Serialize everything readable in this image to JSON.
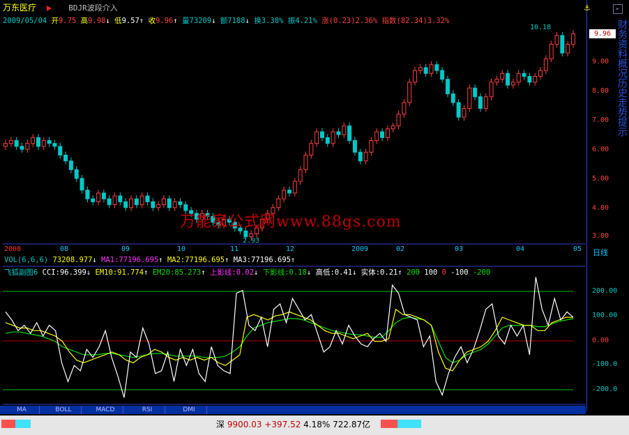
{
  "header": {
    "stock_name": "万东医疗",
    "formula_name": "BDJR波段介入"
  },
  "info": {
    "date": "2009/05/04",
    "open_label": "开",
    "open": "9.75",
    "high_label": "高",
    "high": "9.98",
    "low_label": "低",
    "low": "9.57",
    "close_label": "收",
    "close": "9.96",
    "volume_label": "量",
    "volume": "73209",
    "amount_label": "额",
    "amount": "7188",
    "turnover_label": "换",
    "turnover": "3.38%",
    "amplitude_label": "振",
    "amplitude": "4.21%",
    "change_label": "涨",
    "change": "(0.23)2.36%",
    "index_label": "指数",
    "index": "(82.34)3.32%"
  },
  "price_panel": {
    "current_price": "9.96",
    "peak_label": "10.18",
    "trough_label": "2.93",
    "axis": [
      "9.00",
      "8.00",
      "7.00",
      "6.00",
      "5.00",
      "4.00",
      "3.00"
    ]
  },
  "time_axis": {
    "labels": [
      "2008",
      "08",
      "09",
      "10",
      "11",
      "12",
      "2009",
      "02",
      "03",
      "04",
      "05"
    ],
    "period": "日线"
  },
  "volume": {
    "title": "VOL(6,6,6)",
    "value": "73208.977",
    "ma1": "MA1:77196.695",
    "ma2": "MA2:77196.695",
    "ma3": "MA3:77196.695"
  },
  "indicator": {
    "title": "飞狐副图6",
    "cci": "CCI:96.399",
    "em10": "EM10:91.774",
    "em20": "EM20:85.273",
    "upper_shadow": "上影线:0.02",
    "lower_shadow": "下影线:0.18",
    "high_low": "高低:0.41",
    "body": "实体:0.21",
    "lvl200": "200",
    "lvl100": "100",
    "lvl0": "0",
    "lvlm100": "-100",
    "lvlm200": "-200",
    "axis": [
      "200.00",
      "100.00",
      "0.00",
      "-100.0",
      "-200.0"
    ]
  },
  "watermark": "万能家公式网www.88gs.com",
  "tabs": [
    "MA",
    "BOLL",
    "MACD",
    "RSI",
    "DMI"
  ],
  "status": {
    "market": "深",
    "index": "9900.03",
    "change": "+397.52",
    "pct": "4.18%",
    "amount": "722.87亿"
  },
  "colors": {
    "up": "#ff4040",
    "down": "#00c8c8",
    "grid": "#303ccc",
    "cci": "#ffffff",
    "em10": "#ffff00",
    "em20": "#00e000"
  },
  "chart_data": {
    "type": "line",
    "price_range": [
      2.8,
      10.4
    ],
    "closes": [
      6.2,
      6.3,
      6.1,
      6.0,
      6.2,
      6.4,
      6.1,
      6.3,
      6.2,
      6.1,
      5.8,
      5.6,
      5.3,
      5.0,
      4.6,
      4.3,
      4.2,
      4.5,
      4.3,
      4.1,
      4.4,
      4.2,
      4.0,
      4.3,
      4.1,
      4.4,
      4.2,
      4.0,
      4.1,
      4.3,
      4.0,
      4.2,
      4.1,
      3.9,
      3.8,
      3.6,
      3.8,
      3.7,
      3.5,
      3.4,
      3.6,
      3.5,
      3.3,
      3.2,
      3.0,
      3.1,
      3.3,
      3.6,
      3.8,
      4.0,
      4.3,
      4.6,
      4.5,
      4.9,
      5.3,
      5.8,
      6.2,
      6.6,
      6.4,
      6.2,
      6.6,
      6.5,
      6.8,
      6.3,
      5.9,
      5.6,
      5.9,
      6.3,
      6.6,
      6.4,
      6.7,
      6.8,
      7.2,
      7.6,
      8.3,
      8.7,
      8.8,
      8.6,
      8.9,
      8.7,
      8.4,
      7.9,
      7.6,
      7.1,
      7.4,
      8.1,
      7.8,
      7.4,
      7.8,
      8.3,
      8.4,
      8.6,
      8.2,
      8.3,
      8.6,
      8.5,
      8.3,
      8.5,
      8.7,
      9.1,
      9.6,
      9.9,
      9.3,
      9.6,
      9.96
    ],
    "cci_range": [
      -230,
      270
    ],
    "cci": [
      110,
      80,
      40,
      60,
      30,
      70,
      20,
      60,
      40,
      -80,
      -150,
      -90,
      -110,
      -30,
      -60,
      -20,
      40,
      -60,
      -130,
      -210,
      -40,
      -60,
      50,
      -10,
      -120,
      -110,
      -40,
      -150,
      -30,
      -90,
      -30,
      -120,
      -150,
      -20,
      -90,
      -110,
      -120,
      180,
      190,
      60,
      40,
      90,
      -20,
      120,
      140,
      70,
      160,
      120,
      80,
      100,
      30,
      -40,
      -20,
      40,
      -10,
      60,
      20,
      -10,
      -20,
      10,
      30,
      0,
      210,
      180,
      100,
      90,
      80,
      -20,
      20,
      -150,
      -200,
      -120,
      -60,
      -20,
      -80,
      -30,
      40,
      120,
      140,
      20,
      -10,
      60,
      20,
      60,
      -50,
      240,
      120,
      60,
      160,
      80,
      110,
      90
    ],
    "em10": [
      70,
      60,
      50,
      50,
      40,
      40,
      30,
      20,
      0,
      -40,
      -70,
      -80,
      -70,
      -60,
      -50,
      -40,
      -50,
      -70,
      -80,
      -60,
      -50,
      -30,
      -40,
      -60,
      -70,
      -60,
      -70,
      -60,
      -70,
      -60,
      -80,
      -90,
      -70,
      -50,
      90,
      100,
      90,
      80,
      95,
      100,
      110,
      100,
      90,
      80,
      60,
      40,
      30,
      30,
      20,
      10,
      20,
      30,
      0,
      0,
      10,
      120,
      100,
      100,
      90,
      80,
      60,
      -40,
      -100,
      -110,
      -70,
      -40,
      -30,
      -20,
      0,
      40,
      90,
      80,
      70,
      60,
      60,
      40,
      40,
      70,
      80,
      90,
      90
    ],
    "em20": [
      30,
      35,
      35,
      30,
      25,
      20,
      10,
      0,
      -20,
      -30,
      -40,
      -50,
      -50,
      -50,
      -45,
      -45,
      -50,
      -55,
      -60,
      -55,
      -50,
      -45,
      -45,
      -50,
      -55,
      -55,
      -55,
      -55,
      -60,
      -60,
      -60,
      -55,
      -40,
      -20,
      20,
      50,
      60,
      70,
      75,
      80,
      85,
      85,
      80,
      70,
      60,
      50,
      40,
      35,
      30,
      25,
      25,
      20,
      15,
      15,
      40,
      70,
      85,
      90,
      85,
      80,
      60,
      0,
      -60,
      -80,
      -70,
      -50,
      -40,
      -30,
      -10,
      20,
      50,
      60,
      60,
      60,
      60,
      55,
      55,
      65,
      75,
      80,
      85
    ]
  }
}
